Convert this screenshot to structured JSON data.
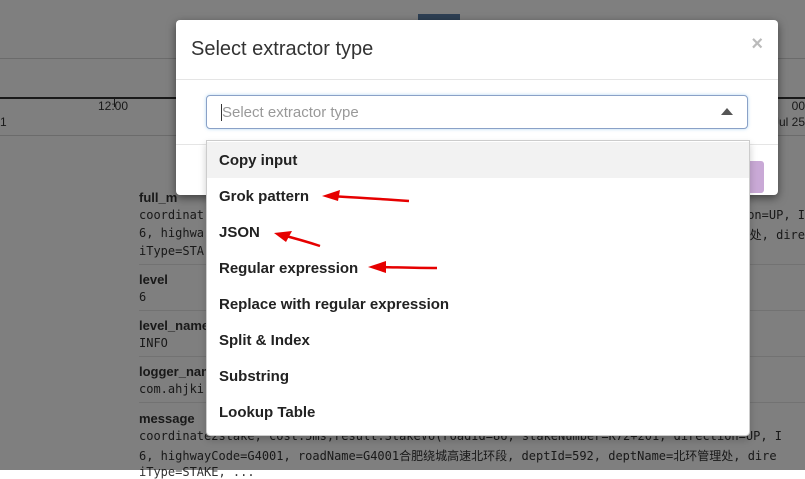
{
  "background": {
    "timeline": {
      "tick_label": "12:00",
      "left_edge_label": "1",
      "right_top_label": "00",
      "right_date_label": "Jul 25"
    },
    "fields": [
      {
        "name": "full_m",
        "lines": [
          "coordinat",
          "6, highwa",
          "iType=STA"
        ],
        "right_lines": [
          "on=UP, I",
          "处, dire",
          ""
        ]
      },
      {
        "name": "level",
        "lines": [
          "6"
        ]
      },
      {
        "name": "level_name",
        "lines": [
          "INFO"
        ]
      },
      {
        "name": "logger_nam",
        "lines": [
          "com.ahjki"
        ]
      },
      {
        "name": "message",
        "lines": [
          "coordinate2stake, cost:5ms,result:StakeVo(roadId=86, stakeNumber=K72+201, direction=UP, I",
          "6, highwayCode=G4001, roadName=G4001合肥绕城高速北环段, deptId=592, deptName=北环管理处, dire",
          "iType=STAKE, ..."
        ]
      }
    ]
  },
  "modal": {
    "title": "Select extractor type",
    "close_label": "×",
    "select": {
      "placeholder": "Select extractor type"
    }
  },
  "dropdown": {
    "options": [
      {
        "label": "Copy input",
        "highlighted": true
      },
      {
        "label": "Grok pattern",
        "annotated": true
      },
      {
        "label": "JSON",
        "annotated": true
      },
      {
        "label": "Regular expression",
        "annotated": true
      },
      {
        "label": "Replace with regular expression"
      },
      {
        "label": "Split & Index"
      },
      {
        "label": "Substring"
      },
      {
        "label": "Lookup Table"
      }
    ]
  },
  "colors": {
    "overlay": "#000000",
    "annotation_arrow": "#e60000",
    "select_border": "#8aa1c7"
  }
}
